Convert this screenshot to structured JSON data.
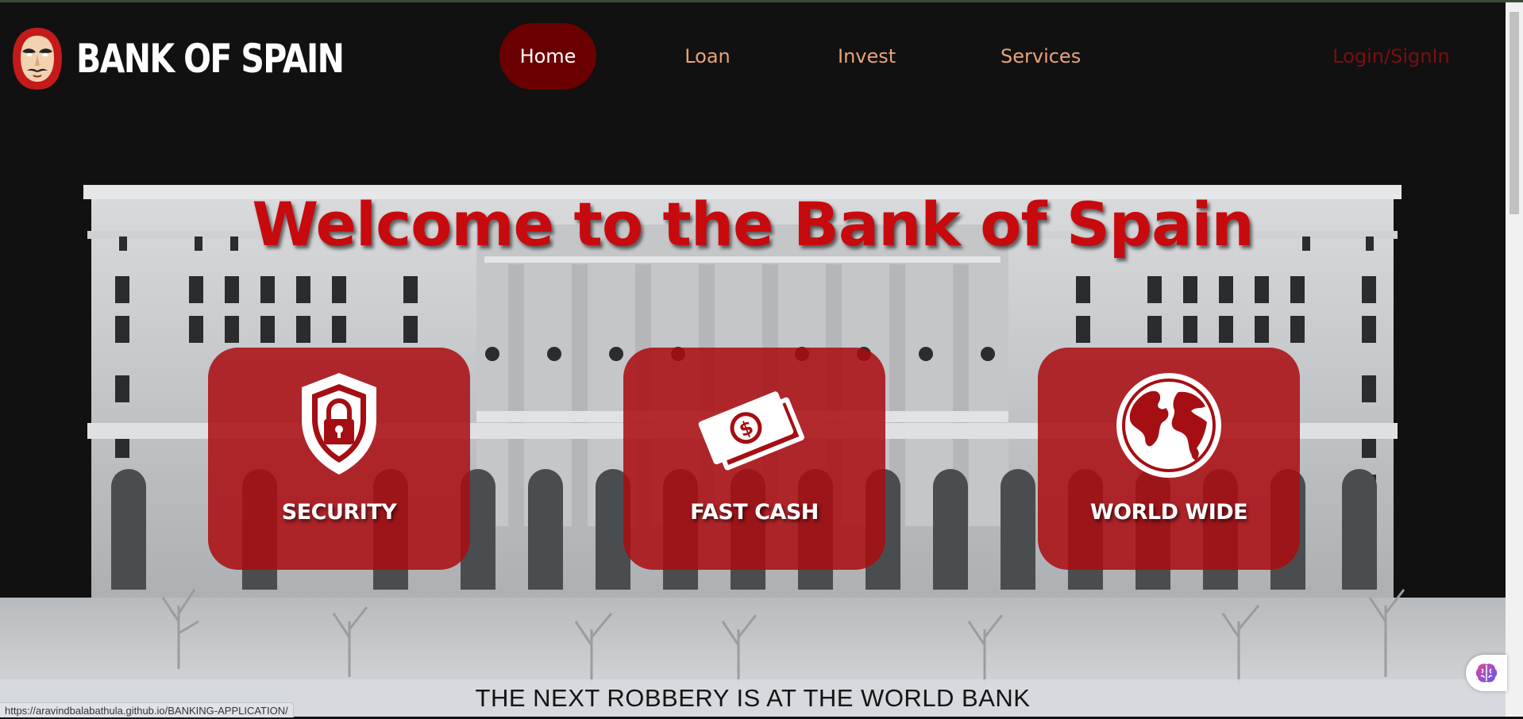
{
  "brand": {
    "name": "BANK OF SPAIN",
    "logo": "dali-mask-icon"
  },
  "nav": {
    "items": [
      {
        "label": "Home",
        "active": true
      },
      {
        "label": "Loan",
        "active": false
      },
      {
        "label": "Invest",
        "active": false
      },
      {
        "label": "Services",
        "active": false
      }
    ],
    "login_label": "Login/SignIn"
  },
  "hero": {
    "headline": "Welcome to the Bank of Spain",
    "cards": [
      {
        "label": "SECURITY",
        "icon": "shield-lock-icon"
      },
      {
        "label": "FAST CASH",
        "icon": "cash-icon"
      },
      {
        "label": "WORLD WIDE",
        "icon": "globe-icon"
      }
    ],
    "tagline": "THE NEXT ROBBERY IS AT THE WORLD BANK"
  },
  "status_bar": {
    "url": "https://aravindbalabathula.github.io/BANKING-APPLICATION/"
  },
  "colors": {
    "background": "#111111",
    "accent_red": "#c70a0d",
    "nav_active_bg": "#6b0000",
    "nav_text": "#e9a27a",
    "login_text": "#7a0f10",
    "card_bg": "#aa0c10"
  },
  "floating_widget": {
    "icon": "brain-icon"
  }
}
